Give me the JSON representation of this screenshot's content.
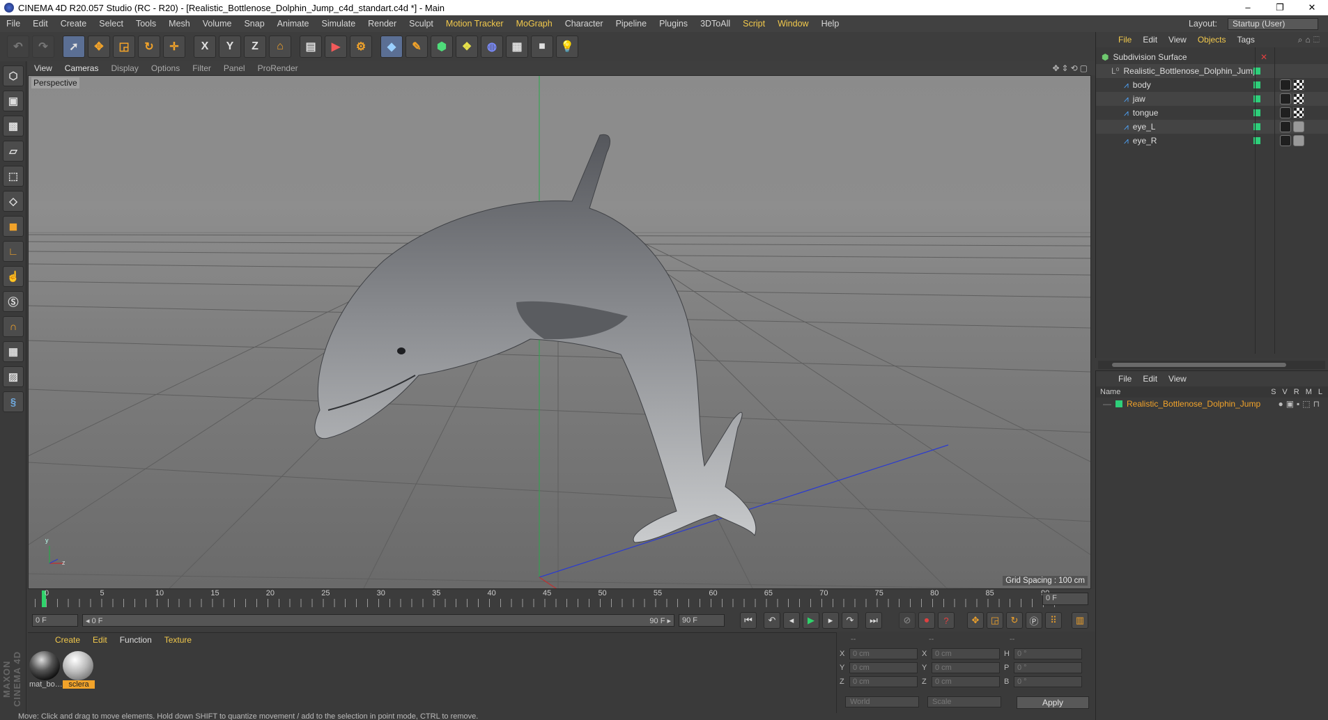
{
  "window": {
    "title": "CINEMA 4D R20.057 Studio (RC - R20) - [Realistic_Bottlenose_Dolphin_Jump_c4d_standart.c4d *] - Main",
    "minimize": "–",
    "restore": "❐",
    "close": "✕"
  },
  "menubar": {
    "items": [
      "File",
      "Edit",
      "Create",
      "Select",
      "Tools",
      "Mesh",
      "Volume",
      "Snap",
      "Animate",
      "Simulate",
      "Render",
      "Sculpt",
      "Motion Tracker",
      "MoGraph",
      "Character",
      "Pipeline",
      "Plugins",
      "3DToAll",
      "Script",
      "Window",
      "Help"
    ],
    "highlighted": [
      "Motion Tracker",
      "MoGraph",
      "Script"
    ],
    "layout_label": "Layout:",
    "layout_value": "Startup (User)"
  },
  "toolbar": {
    "icons": [
      "undo-icon",
      "redo-icon",
      "select-arrow-icon",
      "move-icon",
      "scale-icon",
      "rotate-icon",
      "transform-icon",
      "x-axis-icon",
      "y-axis-icon",
      "z-axis-icon",
      "coordinate-system-icon",
      "render-view-icon",
      "render-picture-queue-icon",
      "render-settings-icon",
      "cube-icon",
      "pen-spline-icon",
      "subdivision-icon",
      "deformer-icon",
      "environment-icon",
      "floor-icon",
      "camera-icon",
      "light-icon"
    ],
    "axis_labels": [
      "X",
      "Y",
      "Z"
    ]
  },
  "left_tools": [
    "make-editable-icon",
    "model-mode-icon",
    "texture-mode-icon",
    "workplane-icon",
    "points-mode-icon",
    "edges-mode-icon",
    "polygons-mode-icon",
    "axis-mode-icon",
    "tweak-mode-icon",
    "solo-icon",
    "magnet-icon",
    "snap-icon",
    "snap-settings-icon",
    "python-icon"
  ],
  "branding": "MAXON CINEMA 4D",
  "viewport": {
    "menu": [
      "View",
      "Cameras",
      "Display",
      "Options",
      "Filter",
      "Panel",
      "ProRender"
    ],
    "active_menu": "Cameras",
    "label": "Perspective",
    "grid_spacing": "Grid Spacing : 100 cm",
    "axis_y": "y",
    "axis_z": "z"
  },
  "timeline": {
    "ticks": [
      "0",
      "5",
      "10",
      "15",
      "20",
      "25",
      "30",
      "35",
      "40",
      "45",
      "50",
      "55",
      "60",
      "65",
      "70",
      "75",
      "80",
      "85",
      "90"
    ],
    "current_frame_right": "0 F",
    "start_field": "0 F",
    "range_start": "◂ 0 F",
    "range_end": "90 F ▸",
    "end_field": "90 F"
  },
  "transport": {
    "buttons": [
      "go-to-start-icon",
      "previous-keyframe-icon",
      "previous-frame-icon",
      "play-icon",
      "next-frame-icon",
      "next-keyframe-icon",
      "go-to-end-icon"
    ],
    "key_buttons": [
      "autokey-icon",
      "record-icon",
      "keyframe-help-icon",
      "move-key-icon",
      "scale-key-icon",
      "rotate-key-icon",
      "param-key-icon",
      "pla-key-icon",
      "timeline-icon"
    ]
  },
  "material_manager": {
    "menu": [
      "Create",
      "Edit",
      "Function",
      "Texture"
    ],
    "materials": [
      {
        "name": "mat_bo…",
        "selected": false
      },
      {
        "name": "sclera",
        "selected": true
      }
    ]
  },
  "coordinates": {
    "header": [
      "--",
      "--",
      "--"
    ],
    "rows": [
      {
        "a": "X",
        "av": "0 cm",
        "b": "X",
        "bv": "0 cm",
        "c": "H",
        "cv": "0 °"
      },
      {
        "a": "Y",
        "av": "0 cm",
        "b": "Y",
        "bv": "0 cm",
        "c": "P",
        "cv": "0 °"
      },
      {
        "a": "Z",
        "av": "0 cm",
        "b": "Z",
        "bv": "0 cm",
        "c": "B",
        "cv": "0 °"
      }
    ],
    "mode": "World",
    "transform": "Scale",
    "apply": "Apply"
  },
  "status": "Move: Click and drag to move elements. Hold down SHIFT to quantize movement / add to the selection in point mode, CTRL to remove.",
  "object_manager": {
    "menu": [
      "File",
      "Edit",
      "View",
      "Objects",
      "Tags"
    ],
    "highlighted": "Objects",
    "objects": [
      {
        "name": "Subdivision Surface",
        "level": 0
      },
      {
        "name": "Realistic_Bottlenose_Dolphin_Jump",
        "level": 1
      },
      {
        "name": "body",
        "level": 2
      },
      {
        "name": "jaw",
        "level": 2
      },
      {
        "name": "tongue",
        "level": 2
      },
      {
        "name": "eye_L",
        "level": 2
      },
      {
        "name": "eye_R",
        "level": 2
      }
    ]
  },
  "layer_manager": {
    "menu": [
      "File",
      "Edit",
      "View"
    ],
    "columns": {
      "name": "Name",
      "flags": [
        "S",
        "V",
        "R",
        "M",
        "L"
      ]
    },
    "rows": [
      {
        "name": "Realistic_Bottlenose_Dolphin_Jump"
      }
    ],
    "accent_color": "#f2a32a"
  },
  "colors": {
    "accent_yellow": "#f2c94c",
    "green_dot": "#2ecf7a",
    "viewport_bg": "#8b8b8b",
    "bone_blue": "#4fa7ff"
  }
}
